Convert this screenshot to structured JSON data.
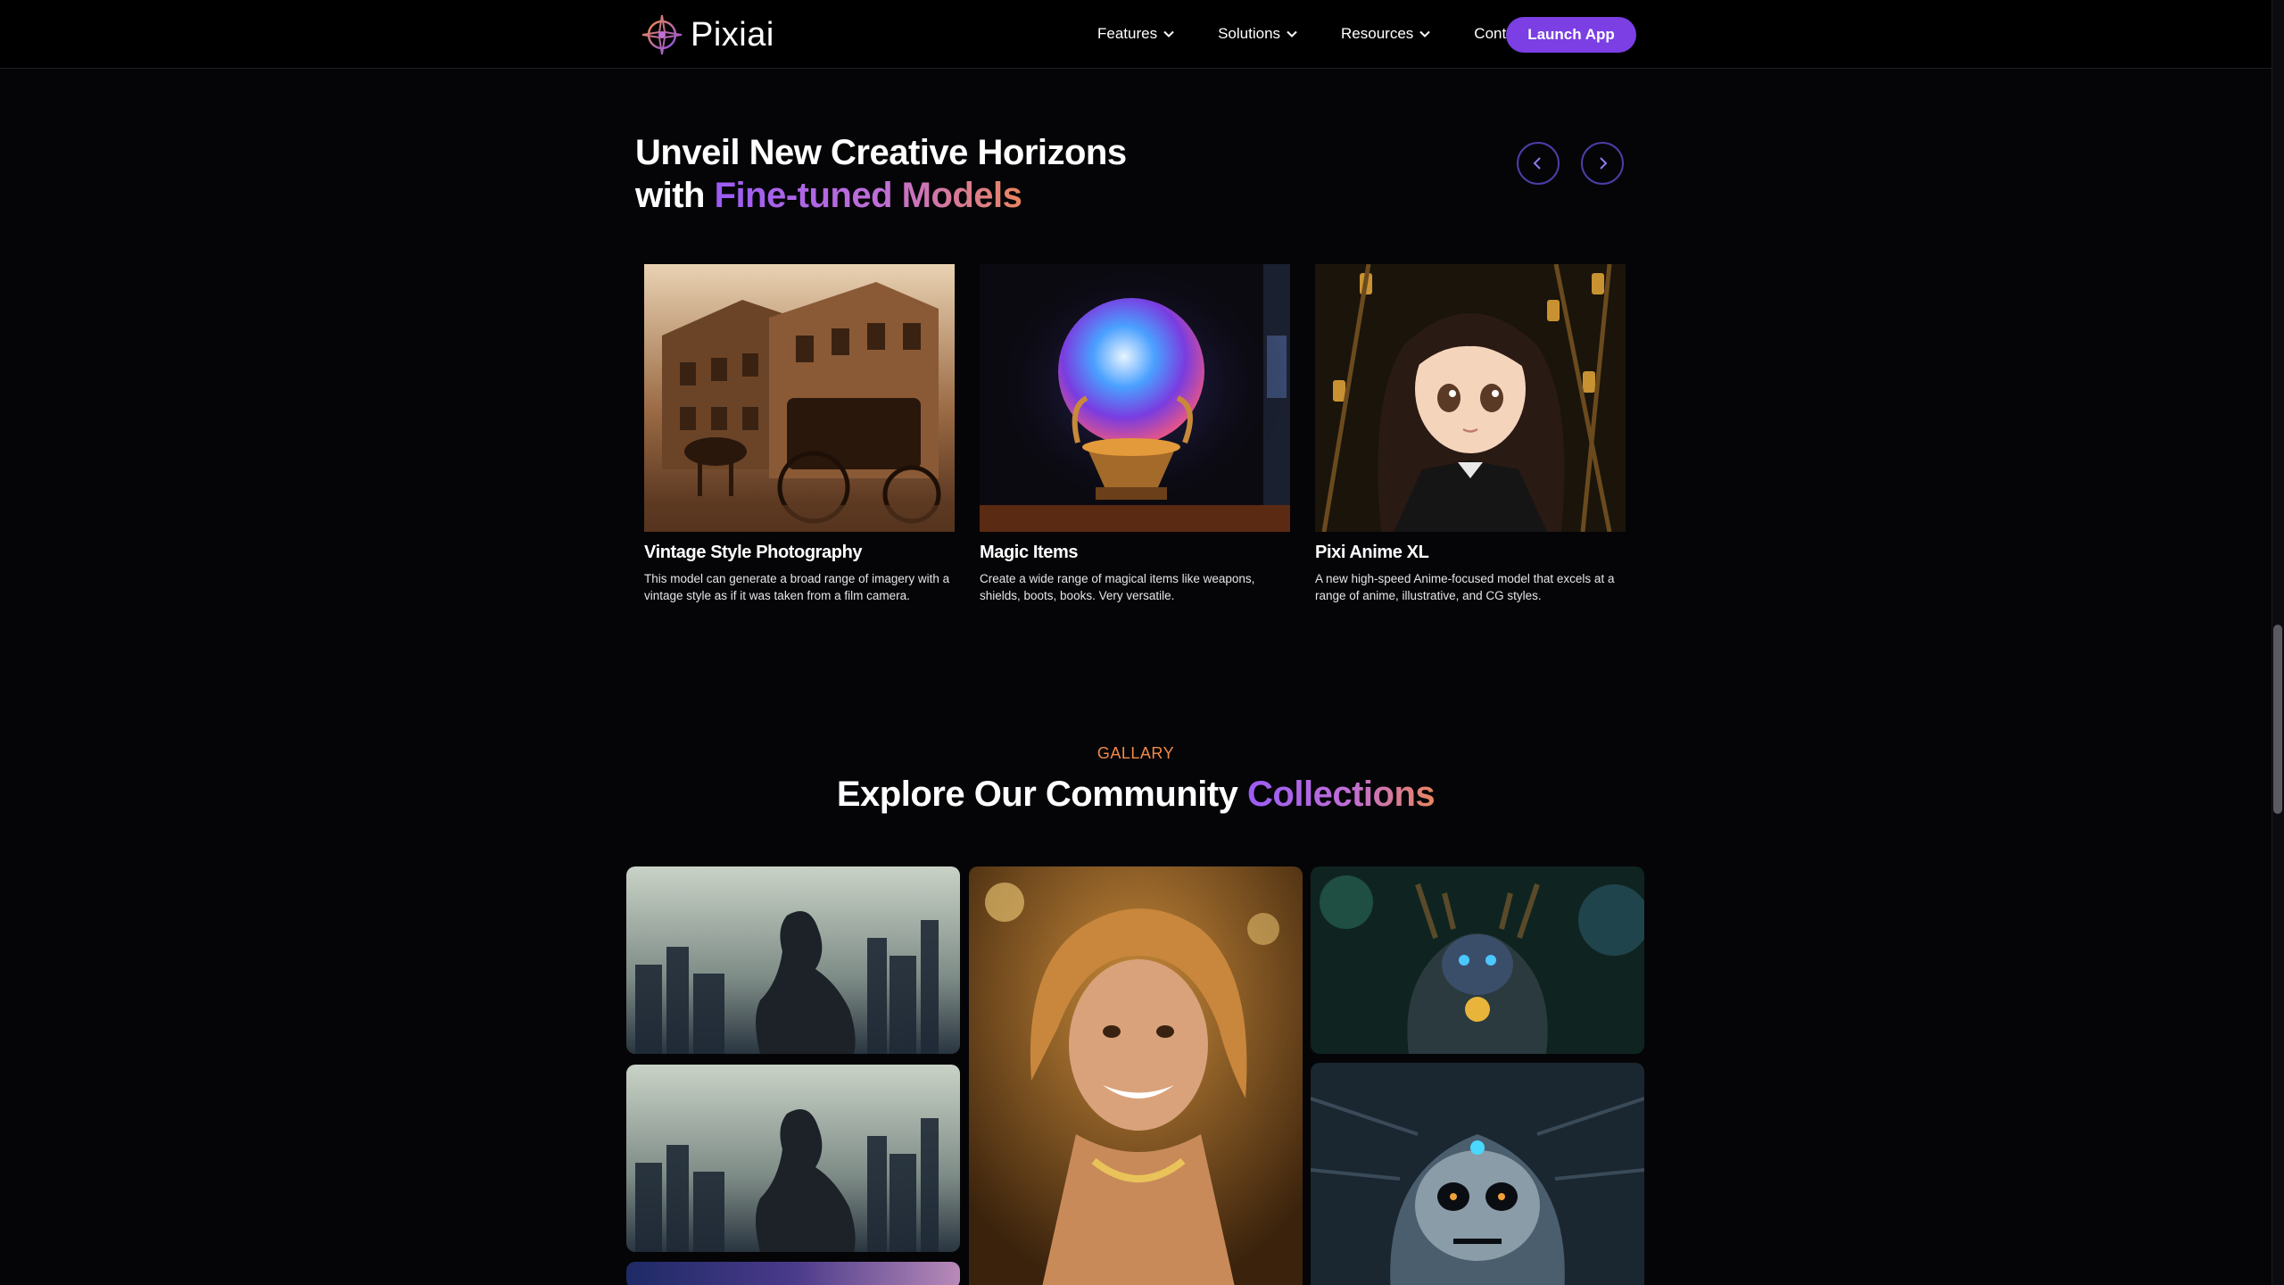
{
  "header": {
    "brand": "Pixiai",
    "nav": [
      {
        "label": "Features",
        "dropdown": true
      },
      {
        "label": "Solutions",
        "dropdown": true
      },
      {
        "label": "Resources",
        "dropdown": true
      },
      {
        "label": "Contact",
        "dropdown": false
      }
    ],
    "cta": "Launch App"
  },
  "models": {
    "title_line1": "Unveil New Creative Horizons",
    "title_line2_prefix": "with ",
    "title_line2_highlight": "Fine-tuned Models",
    "cards": [
      {
        "title": "Vintage Style Photography",
        "desc": "This model can generate a broad range of imagery with a vintage style as if it was taken from a film camera."
      },
      {
        "title": "Magic Items",
        "desc": "Create a wide range of magical items like weapons, shields, boots, books. Very versatile."
      },
      {
        "title": "Pixi Anime XL",
        "desc": "A new high-speed Anime-focused model that excels at a range of anime, illustrative, and CG styles."
      }
    ]
  },
  "gallery": {
    "eyebrow": "GALLARY",
    "title_prefix": "Explore Our Community ",
    "title_highlight": "Collections"
  },
  "colors": {
    "accent": "#7b3fe4",
    "gradient_start": "#9b5cf6",
    "gradient_end": "#e9855f",
    "eyebrow": "#f08a4b",
    "background": "#050507"
  }
}
